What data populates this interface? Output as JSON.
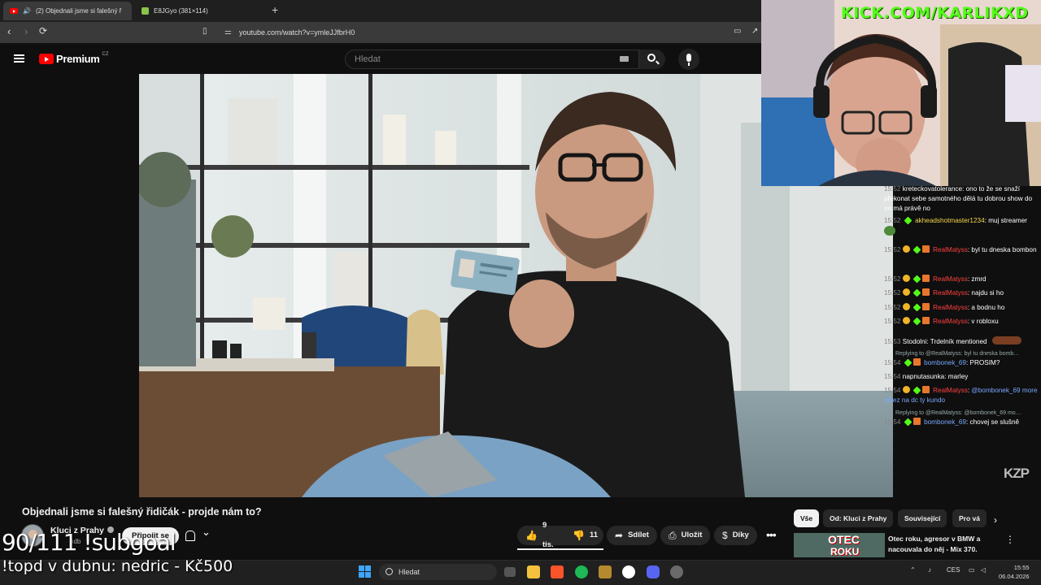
{
  "browser": {
    "tabs": [
      {
        "label": "(2) Objednali jsme si falešný ř"
      },
      {
        "label": "E8JGyo (381×114)"
      }
    ],
    "new_tab": "+",
    "address": "youtube.com/watch?v=ymleJJfbrH0"
  },
  "youtube": {
    "brand": "Premium",
    "region": "CZ",
    "search_placeholder": "Hledat",
    "video_watermark": "KZP",
    "video_title": "Objednali jsme si falešný řidičák - projde nám to?",
    "channel": {
      "name": "Kluci z Prahy",
      "subs_partial": "odb"
    },
    "join_label": "Připojit se",
    "actions": {
      "likes": "9 tis.",
      "dislikes": "11",
      "share": "Sdílet",
      "save": "Uložit",
      "thanks": "Díky"
    },
    "chips": [
      "Vše",
      "Od: Kluci z Prahy",
      "Související",
      "Pro vá"
    ],
    "recommended": {
      "thumb_text_1": "OTEC",
      "thumb_text_2": "ROKU",
      "title": "Otec roku, agresor v BMW a nacouvala do něj - Mix 370."
    }
  },
  "stream": {
    "kick_url": "KICK.COM/KARLIKXD",
    "subgoal": "90/111 !subgoal",
    "topd": "!topd v dubnu: nedric - Kč500"
  },
  "chat": [
    {
      "time": "15:52",
      "user": "kreteckovatolerance",
      "text": "ono to že se snaží překonat sebe samotného dělá tu dobrou show do on má právě no"
    },
    {
      "time": "15:52",
      "user": "akheadshotmaster1234",
      "text": "muj streamer"
    },
    {
      "time": "15:52",
      "user": "RealMatyss",
      "text": "byl tu dneska bombon"
    },
    {
      "time": "15:52",
      "user": "RealMatyss",
      "text": "zmrd"
    },
    {
      "time": "15:52",
      "user": "RealMatyss",
      "text": "najdu si ho"
    },
    {
      "time": "15:52",
      "user": "RealMatyss",
      "text": "a bodnu ho"
    },
    {
      "time": "15:52",
      "user": "RealMatyss",
      "text": "v robloxu"
    },
    {
      "time": "15:53",
      "user": "Stodolni",
      "text": "Trdelník mentioned"
    },
    {
      "time": "15:54",
      "reply": "Replying to @RealMatyss: byl tu dneska bomb…",
      "user": "bombonek_69",
      "text": "PROSIM?"
    },
    {
      "time": "15:54",
      "user": "napnutasunka",
      "text": "marley"
    },
    {
      "time": "15:54",
      "user": "RealMatyss",
      "text": "@bombonek_69 more přilez na dc ty kundo"
    },
    {
      "time": "15:54",
      "reply": "Replying to @RealMatyss: @bombonek_69 mo…",
      "user": "bombonek_69",
      "text": "chovej se slušně"
    }
  ],
  "taskbar": {
    "search": "Hledat",
    "lang": "CES",
    "time": "15:55",
    "date": "06.04.2026"
  },
  "colors": {
    "youtube_red": "#ff0000",
    "kick_green": "#53fc18",
    "background": "#0f0f0f"
  }
}
